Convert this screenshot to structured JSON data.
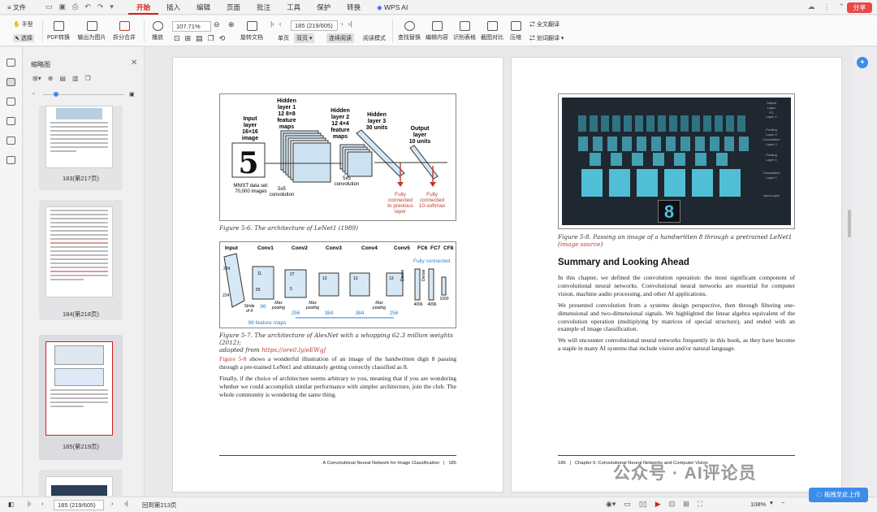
{
  "menubar": {
    "file_label": "文件",
    "tabs": [
      "开始",
      "插入",
      "编辑",
      "页面",
      "批注",
      "工具",
      "保护",
      "转换",
      "WPS AI"
    ],
    "share_label": "分享"
  },
  "toolbar": {
    "hand": "手型",
    "select": "选择",
    "pdf_convert": "PDF转换",
    "export_image": "输出为图片",
    "split_merge": "拆分合并",
    "play": "播放",
    "zoom_value": "107.71%",
    "rotate_doc": "旋转文档",
    "single": "单页",
    "double": "双页",
    "continuous": "连续阅读",
    "read_mode": "阅读模式",
    "find_replace": "查找替换",
    "edit_content": "编辑内容",
    "recognize_table": "识别表格",
    "screenshot_compare": "截图对比",
    "compress": "压缩",
    "full_translate": "全文翻译",
    "selection_translate": "划词翻译",
    "page_input": "185 (219/605)"
  },
  "thumbs": {
    "title": "缩略图",
    "items": [
      {
        "label": "183(第217页)"
      },
      {
        "label": "184(第218页)"
      },
      {
        "label": "185(第219页)"
      },
      {
        "label": ""
      }
    ]
  },
  "left_page": {
    "fig1": {
      "input_layer": [
        "Input",
        "layer",
        "16×16",
        "image"
      ],
      "hidden1": [
        "Hidden",
        "layer 1",
        "12 8×8",
        "feature",
        "maps"
      ],
      "hidden2": [
        "Hidden",
        "layer 2",
        "12 4×4",
        "feature",
        "maps"
      ],
      "hidden3": [
        "Hidden",
        "layer 3",
        "30 units"
      ],
      "output": [
        "Output",
        "layer",
        "10 units"
      ],
      "mnist": [
        "MNIST data set:",
        "70,000 images"
      ],
      "conv1": [
        "5x5",
        "convolution"
      ],
      "conv2": [
        "5x5",
        "convolution"
      ],
      "fc_prev": [
        "Fully",
        "connected",
        "to previous",
        "layer"
      ],
      "fc_soft": [
        "Fully",
        "connected",
        "10-softmax"
      ]
    },
    "fig1_caption": "Figure 5-6. The architecture of LeNet1 (1989)",
    "fig2": {
      "labels": [
        "Input",
        "Conv1",
        "Conv2",
        "Conv3",
        "Conv4",
        "Conv5",
        "FC6",
        "FC7",
        "CF8"
      ],
      "fully_connected": "Fully connected",
      "bottom_nums": [
        "96",
        "256",
        "384",
        "384",
        "256",
        "4096",
        "4096",
        "1000"
      ],
      "feature_maps": "96 feature maps",
      "strides": [
        "Stride",
        "of 4"
      ],
      "max_pool": [
        "Max",
        "pooling"
      ],
      "top_nums": [
        "224",
        "11",
        "5",
        "27",
        "13",
        "13",
        "13",
        "55",
        "224",
        "3",
        "3",
        "3",
        "3",
        "3",
        "3",
        "3",
        "3",
        "Dense",
        "Dense"
      ]
    },
    "fig2_caption_a": "Figure 5-7. The architecture of AlexNet with a whopping 62.3 million weights (2012);",
    "fig2_caption_b": "adapted from ",
    "fig2_caption_link": "https://oreil.ly/eEWgJ",
    "para1_link": "Figure 5-8",
    "para1": " shows a wonderful illustration of an image of the handwritten digit 8 passing through a pre-trained LeNet1 and ultimately getting correctly classified as 8.",
    "para2": "Finally, if the choice of architecture seems arbitrary to you, meaning that if you are wondering whether we could accomplish similar performance with simpler architecture, join the club. The whole community is wondering the same thing.",
    "footer_title": "A Convolutional Neural Network for Image Classification",
    "footer_sep": "|",
    "footer_num": "185"
  },
  "right_page": {
    "fig_labels": [
      "Output",
      "Layer",
      "FC",
      "Layer 1",
      "Pooling",
      "Layer 2",
      "Convolution",
      "Layer 2",
      "Pooling",
      "Layer 1",
      "Convolution",
      "Layer 1",
      "Input Layer"
    ],
    "fig_caption": "Figure 5-8. Passing an image of a handwritten 8 through a pretrained LeNet1 (",
    "fig_caption_link": "image source",
    "fig_caption_end": ")",
    "heading": "Summary and Looking Ahead",
    "p1": "In this chapter, we defined the convolution operation: the most significant component of convolutional neural networks. Convolutional neural networks are essential for computer vision, machine audio processing, and other AI applications.",
    "p2": "We presented convolution from a systems design perspective, then through filtering one-dimensional and two-dimensional signals. We highlighted the linear algebra equivalent of the convolution operation (multiplying by matrices of special structure), and ended with an example of image classification.",
    "p3": "We will encounter convolutional neural networks frequently in this book, as they have become a staple in many AI systems that include vision and/or natural language.",
    "footer_num": "186",
    "footer_sep": "|",
    "footer_title": "Chapter 5: Convolutional Neural Networks and Computer Vision"
  },
  "statusbar": {
    "page_input": "185 (219/605)",
    "back_label": "回到第213页",
    "zoom": "108%"
  },
  "watermark": "公众号 · AI评论员",
  "upload_label": "拖拽至此上传"
}
